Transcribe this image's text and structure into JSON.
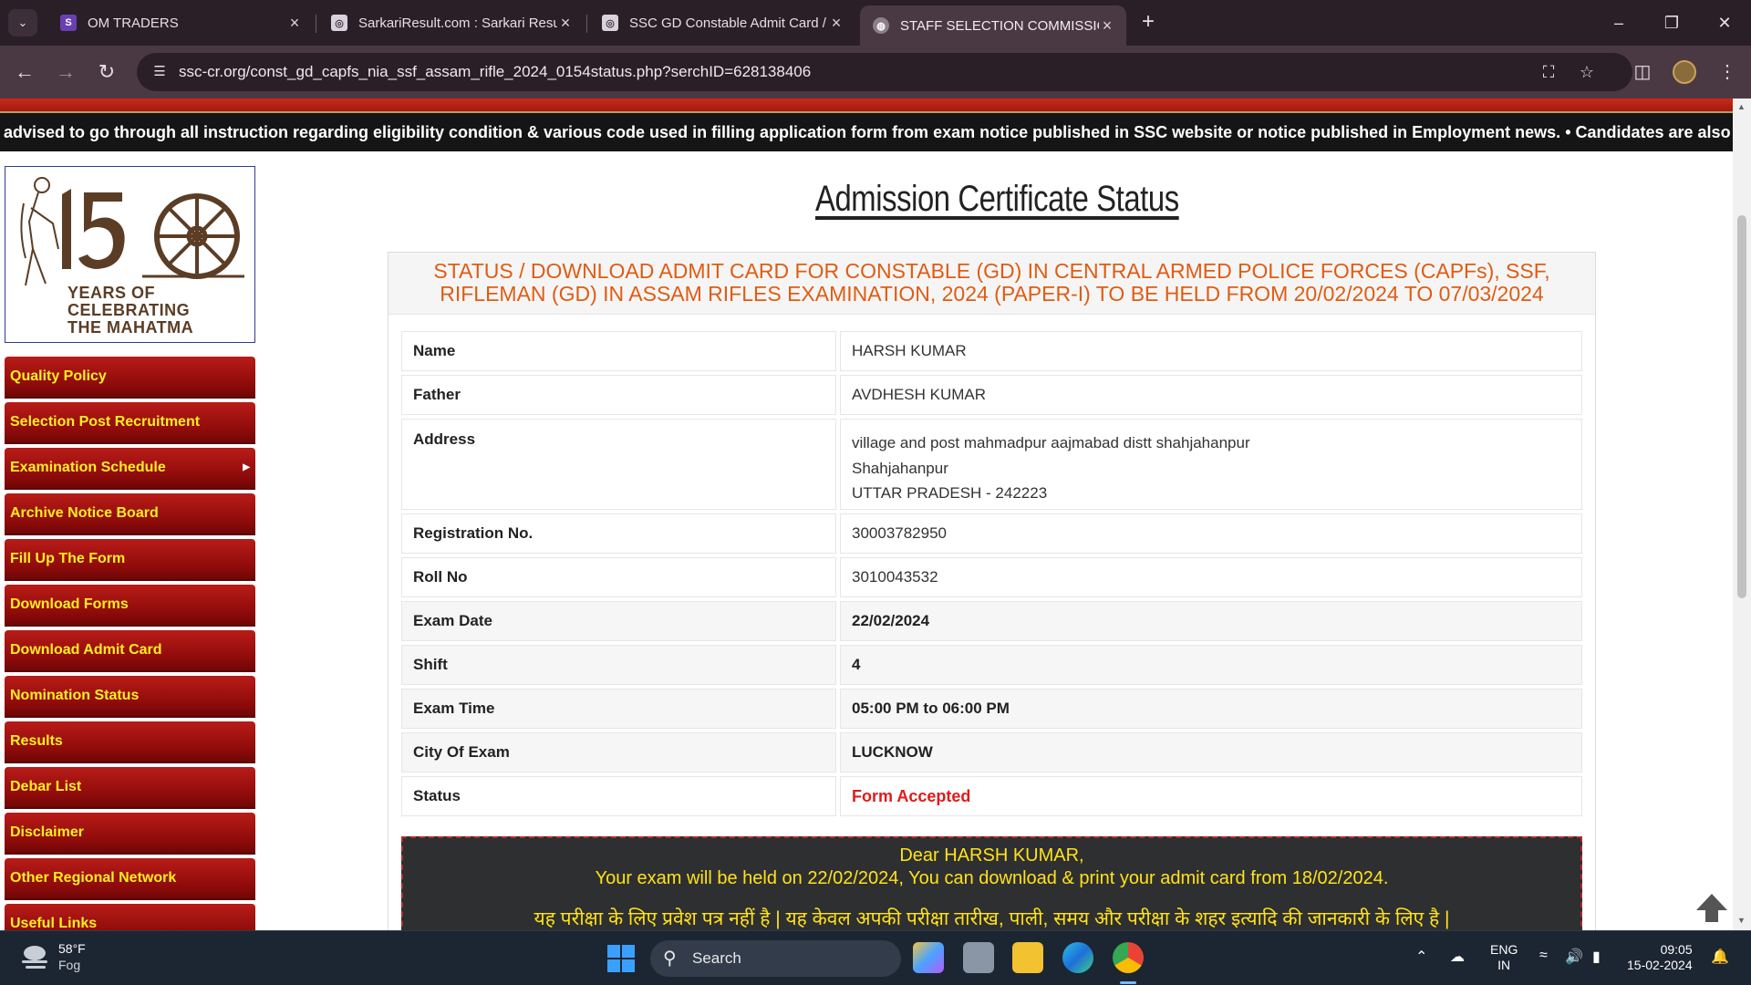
{
  "browser": {
    "tabs": [
      {
        "title": "OM TRADERS",
        "active": false
      },
      {
        "title": "SarkariResult.com : Sarkari Resu",
        "active": false
      },
      {
        "title": "SSC GD Constable Admit Card /",
        "active": false
      },
      {
        "title": "STAFF SELECTION COMMISSION",
        "active": true
      }
    ],
    "url": "ssc-cr.org/const_gd_capfs_nia_ssf_assam_rifle_2024_0154status.php?serchID=628138406"
  },
  "page": {
    "marquee": "advised to go through all instruction regarding eligibility condition & various code used in filling application form from exam notice published in SSC website or notice published in Employment news.  • Candidates are also advis",
    "logo": {
      "line1": "YEARS OF",
      "line2": "CELEBRATING",
      "line3": "THE MAHATMA"
    },
    "menu": [
      {
        "label": "Quality Policy",
        "has_submenu": false
      },
      {
        "label": "Selection Post Recruitment",
        "has_submenu": false
      },
      {
        "label": "Examination Schedule",
        "has_submenu": true
      },
      {
        "label": "Archive Notice Board",
        "has_submenu": false
      },
      {
        "label": "Fill Up The Form",
        "has_submenu": false
      },
      {
        "label": "Download Forms",
        "has_submenu": false
      },
      {
        "label": "Download Admit Card",
        "has_submenu": false
      },
      {
        "label": "Nomination Status",
        "has_submenu": false
      },
      {
        "label": "Results",
        "has_submenu": false
      },
      {
        "label": "Debar List",
        "has_submenu": false
      },
      {
        "label": "Disclaimer",
        "has_submenu": false
      },
      {
        "label": "Other Regional Network",
        "has_submenu": false
      },
      {
        "label": "Useful Links",
        "has_submenu": false
      }
    ],
    "title": "Admission Certificate Status",
    "panel_heading_1": "STATUS / DOWNLOAD ADMIT CARD FOR CONSTABLE (GD) IN CENTRAL ARMED POLICE FORCES (CAPFs), SSF,",
    "panel_heading_2": "RIFLEMAN (GD) IN ASSAM RIFLES EXAMINATION, 2024 (PAPER-I) TO BE HELD FROM 20/02/2024 TO 07/03/2024",
    "details": {
      "name_label": "Name",
      "name": "HARSH KUMAR",
      "father_label": "Father",
      "father": "AVDHESH KUMAR",
      "address_label": "Address",
      "address_1": "village and post mahmadpur aajmabad distt shahjahanpur",
      "address_2": "Shahjahanpur",
      "address_3": "UTTAR PRADESH - 242223",
      "registration_label": "Registration No.",
      "registration": "30003782950",
      "roll_label": "Roll No",
      "roll": "3010043532",
      "exam_date_label": "Exam Date",
      "exam_date": "22/02/2024",
      "shift_label": "Shift",
      "shift": "4",
      "exam_time_label": "Exam Time",
      "exam_time": "05:00 PM to 06:00 PM",
      "city_label": "City Of Exam",
      "city": "LUCKNOW",
      "status_label": "Status",
      "status": "Form Accepted"
    },
    "notice": {
      "greeting": "Dear HARSH KUMAR,",
      "line": "Your exam will be held on 22/02/2024, You can download & print your admit card from 18/02/2024.",
      "hindi": "यह परीक्षा के लिए प्रवेश पत्र नहीं है | यह केवल अपकी परीक्षा तारीख, पाली, समय और परीक्षा के शहर इत्यादि की जानकारी के लिए है |"
    },
    "colors": {
      "menu_red": "#9b0f0e",
      "menu_text": "#ffee22",
      "heading_orange": "#e05c12",
      "status_red": "#e01a1a"
    }
  },
  "taskbar": {
    "weather_temp": "58°F",
    "weather_desc": "Fog",
    "search_label": "Search",
    "lang_1": "ENG",
    "lang_2": "IN",
    "time": "09:05",
    "date": "15-02-2024"
  }
}
